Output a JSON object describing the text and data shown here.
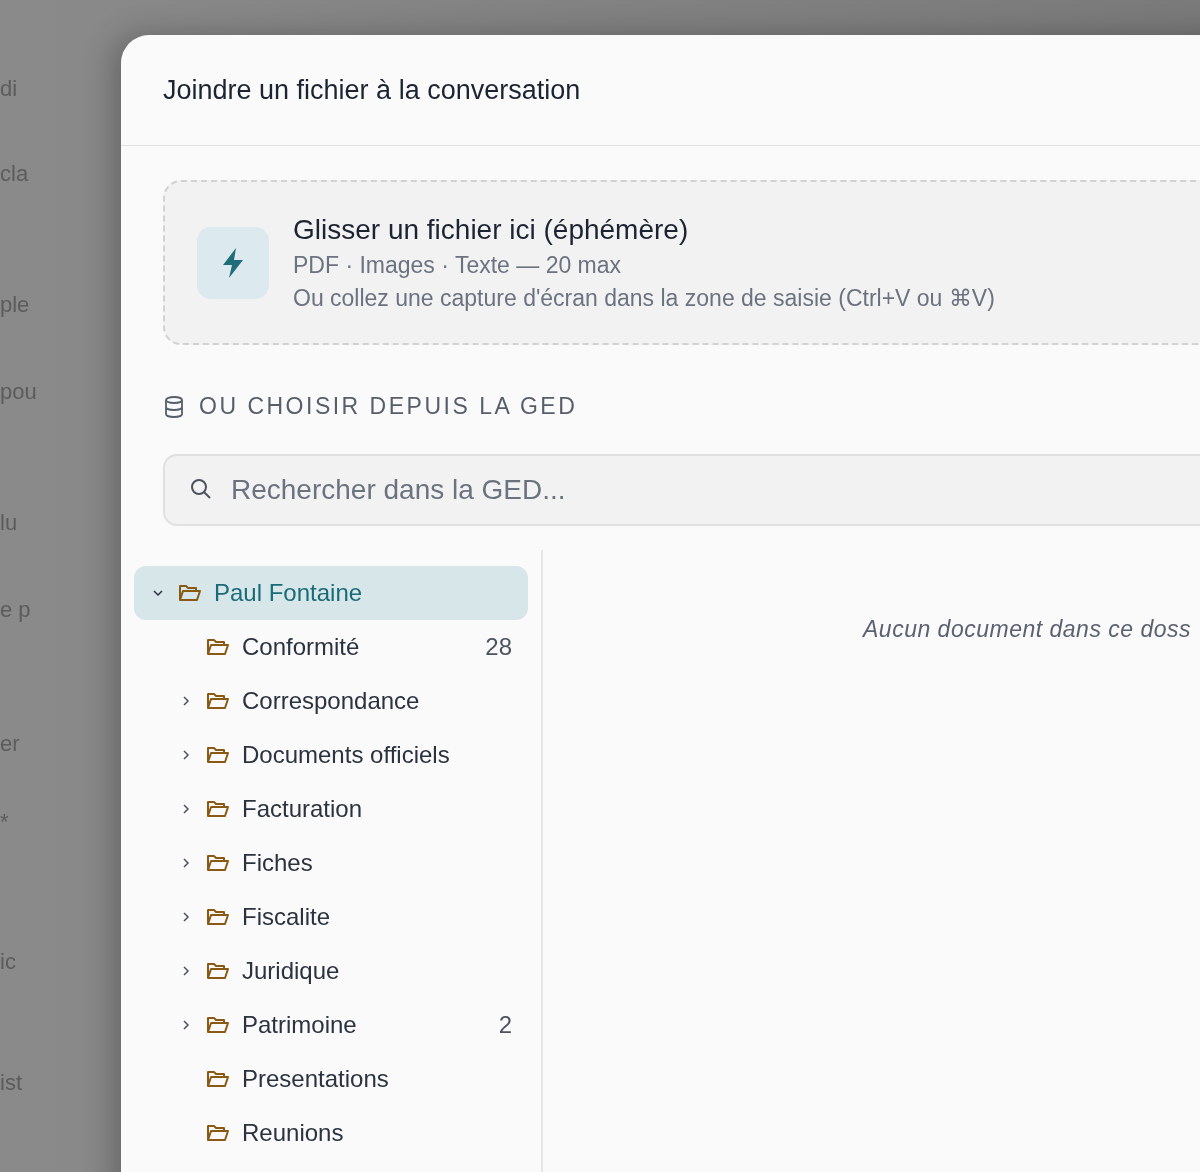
{
  "backdrop": {
    "fragments": [
      "di",
      "cla",
      "ple",
      "pou",
      "lu",
      "e p",
      "er",
      "*",
      "ic",
      "ist"
    ]
  },
  "dialog": {
    "title": "Joindre un fichier à la conversation",
    "dropzone": {
      "title": "Glisser un fichier ici (éphémère)",
      "formats": "PDF · Images · Texte — 20 max",
      "hint": "Ou collez une capture d'écran dans la zone de saisie (Ctrl+V ou ⌘V)"
    },
    "section_label": "OU CHOISIR DEPUIS LA GED",
    "search": {
      "placeholder": "Rechercher dans la GED..."
    },
    "tree": [
      {
        "label": "Paul Fontaine",
        "selected": true,
        "expanded": true,
        "expandable": true,
        "children": [
          {
            "label": "Conformité",
            "count": "28",
            "selected": false,
            "expandable": false
          },
          {
            "label": "Correspondance",
            "selected": false,
            "expandable": true
          },
          {
            "label": "Documents officiels",
            "selected": false,
            "expandable": true
          },
          {
            "label": "Facturation",
            "selected": false,
            "expandable": true
          },
          {
            "label": "Fiches",
            "selected": false,
            "expandable": true
          },
          {
            "label": "Fiscalite",
            "selected": false,
            "expandable": true
          },
          {
            "label": "Juridique",
            "selected": false,
            "expandable": true
          },
          {
            "label": "Patrimoine",
            "count": "2",
            "selected": false,
            "expandable": true
          },
          {
            "label": "Presentations",
            "selected": false,
            "expandable": false
          },
          {
            "label": "Reunions",
            "selected": false,
            "expandable": false
          }
        ]
      }
    ],
    "empty_message": "Aucun document dans ce doss"
  }
}
